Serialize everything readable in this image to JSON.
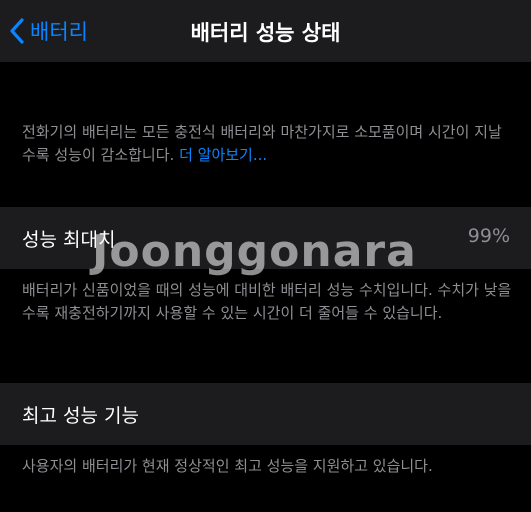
{
  "nav": {
    "back_label": "배터리",
    "title": "배터리 성능 상태",
    "back_icon": "chevron-left-icon"
  },
  "intro": {
    "text": "전화기의 배터리는 모든 충전식 배터리와 마찬가지로 소모품이며 시간이 지날수록 성능이 감소합니다. ",
    "link": "더 알아보기..."
  },
  "max_capacity": {
    "label": "성능 최대치",
    "value": "99%",
    "description": "배터리가 신품이었을 때의 성능에 대비한 배터리 성능 수치입니다. 수치가 낮을수록 재충전하기까지 사용할 수 있는 시간이 더 줄어들 수 있습니다."
  },
  "peak_performance": {
    "label": "최고 성능 기능",
    "description": "사용자의 배터리가 현재 정상적인 최고 성능을 지원하고 있습니다."
  },
  "watermark": "Joonggonara",
  "colors": {
    "accent": "#0a84ff",
    "background": "#000000",
    "cell_background": "#1c1c1e",
    "secondary_text": "#8e8e93"
  }
}
